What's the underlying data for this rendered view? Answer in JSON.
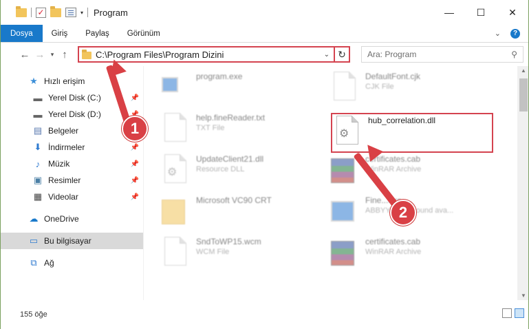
{
  "window": {
    "title": "Program",
    "controls": {
      "minimize": "—",
      "maximize": "☐",
      "close": "✕"
    }
  },
  "ribbon": {
    "tabs": [
      "Dosya",
      "Giriş",
      "Paylaş",
      "Görünüm"
    ],
    "help": "?"
  },
  "navigation": {
    "address": "C:\\Program Files\\Program Dizini",
    "search_placeholder": "Ara: Program"
  },
  "sidebar": {
    "items": [
      {
        "label": "Hızlı erişim",
        "icon": "star-icon",
        "pinned": false
      },
      {
        "label": "Yerel Disk (C:)",
        "icon": "drive-icon",
        "pinned": true
      },
      {
        "label": "Yerel Disk (D:)",
        "icon": "drive-icon",
        "pinned": true
      },
      {
        "label": "Belgeler",
        "icon": "documents-icon",
        "pinned": true
      },
      {
        "label": "İndirmeler",
        "icon": "download-icon",
        "pinned": true
      },
      {
        "label": "Müzik",
        "icon": "music-icon",
        "pinned": true
      },
      {
        "label": "Resimler",
        "icon": "pictures-icon",
        "pinned": true
      },
      {
        "label": "Videolar",
        "icon": "videos-icon",
        "pinned": true
      },
      {
        "label": "OneDrive",
        "icon": "onedrive-icon",
        "pinned": false
      },
      {
        "label": "Bu bilgisayar",
        "icon": "computer-icon",
        "pinned": false,
        "selected": true
      },
      {
        "label": "Ağ",
        "icon": "network-icon",
        "pinned": false
      }
    ]
  },
  "files": [
    {
      "name": "program.exe",
      "type": "",
      "icon": "exe-icon",
      "blurred": true
    },
    {
      "name": "DefaultFont.cjk",
      "type": "CJK File",
      "icon": "doc-icon",
      "blurred": true
    },
    {
      "name": "help.fineReader.txt",
      "type": "TXT File",
      "icon": "doc-icon",
      "blurred": true
    },
    {
      "name": "hub_correlation.dll",
      "type": "",
      "icon": "dll-gear-icon",
      "blurred": false,
      "highlighted": true
    },
    {
      "name": "UpdateClient21.dll",
      "type": "Resource DLL",
      "icon": "dll-gear-icon",
      "blurred": true
    },
    {
      "name": "certificates.cab",
      "type": "WinRAR Archive",
      "icon": "winrar-icon",
      "blurred": true
    },
    {
      "name": "Microsoft VC90 CRT",
      "type": "",
      "icon": "folder-icon",
      "blurred": true
    },
    {
      "name": "Fine...exe",
      "type": "ABBYY Background ava...",
      "icon": "exe-icon",
      "blurred": true
    },
    {
      "name": "SndToWP15.wcm",
      "type": "WCM File",
      "icon": "doc-icon",
      "blurred": true
    },
    {
      "name": "certificates.cab",
      "type": "WinRAR Archive",
      "icon": "winrar-icon",
      "blurred": true
    }
  ],
  "status": {
    "count": "155 öğe"
  },
  "callouts": [
    "1",
    "2"
  ],
  "colors": {
    "accent": "#1979ca",
    "highlight": "#d4434f",
    "callout": "#d94045"
  }
}
